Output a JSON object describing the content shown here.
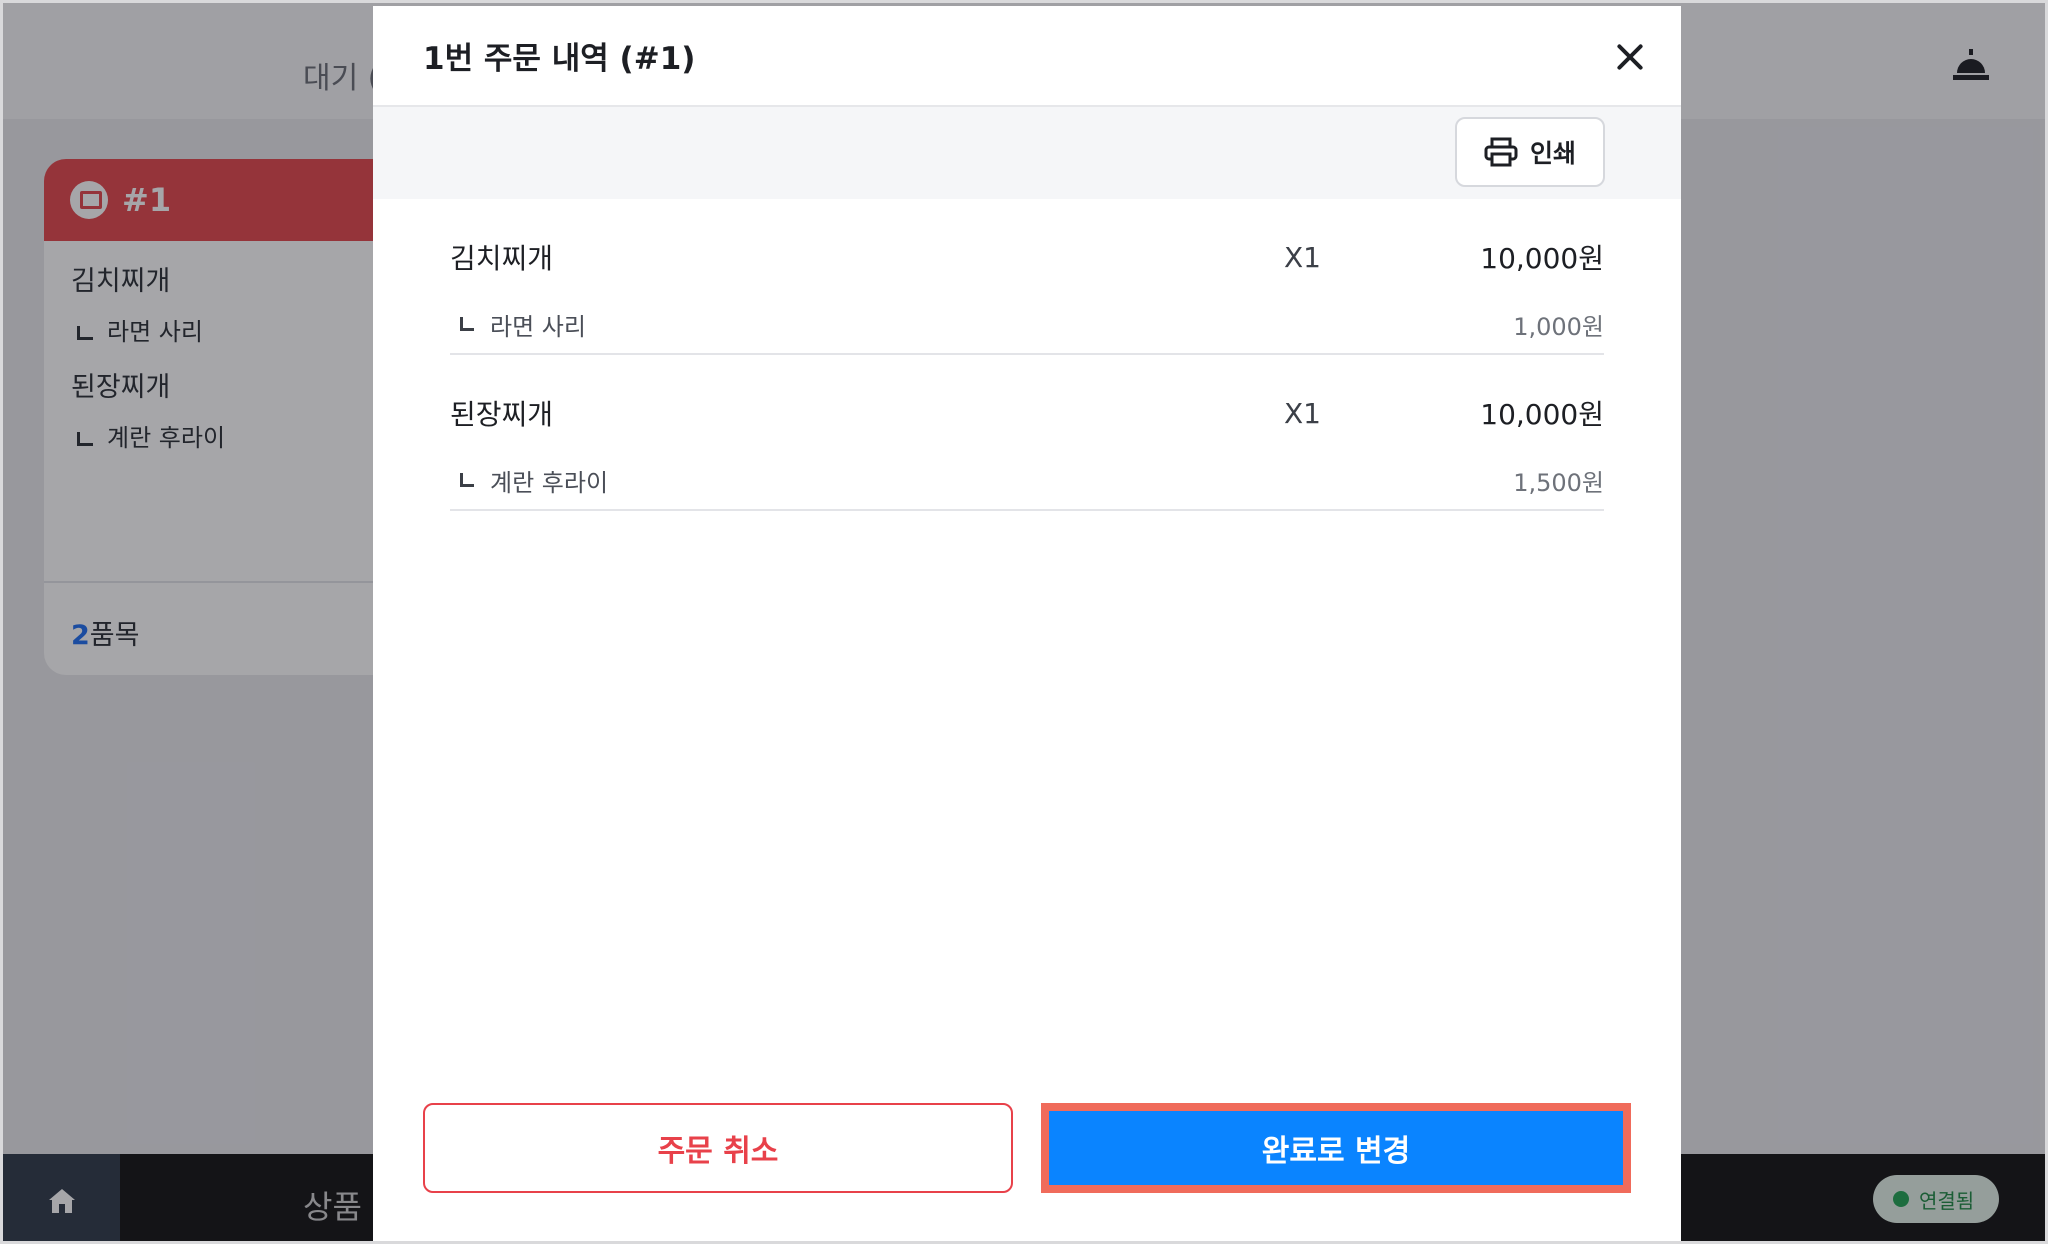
{
  "background": {
    "header_tab_text": "대기 (",
    "order_card": {
      "number": "#1",
      "items": [
        {
          "name": "김치찌개",
          "option": "라면 사리"
        },
        {
          "name": "된장찌개",
          "option": "계란 후라이"
        }
      ],
      "count": "2",
      "count_suffix": "품목"
    },
    "bottom_label": "상품",
    "connection_status": "연결됨"
  },
  "modal": {
    "title": "1번 주문 내역 (#1)",
    "print_label": "인쇄",
    "items": [
      {
        "name": "김치찌개",
        "qty": "X1",
        "price": "10,000원",
        "option": "라면 사리",
        "option_price": "1,000원"
      },
      {
        "name": "된장찌개",
        "qty": "X1",
        "price": "10,000원",
        "option": "계란 후라이",
        "option_price": "1,500원"
      }
    ],
    "cancel_label": "주문 취소",
    "complete_label": "완료로 변경"
  },
  "colors": {
    "accent_blue": "#0a84ff",
    "danger_red": "#e8414a",
    "card_header_red": "#e4474d",
    "highlight_outline": "#f06b5b"
  }
}
